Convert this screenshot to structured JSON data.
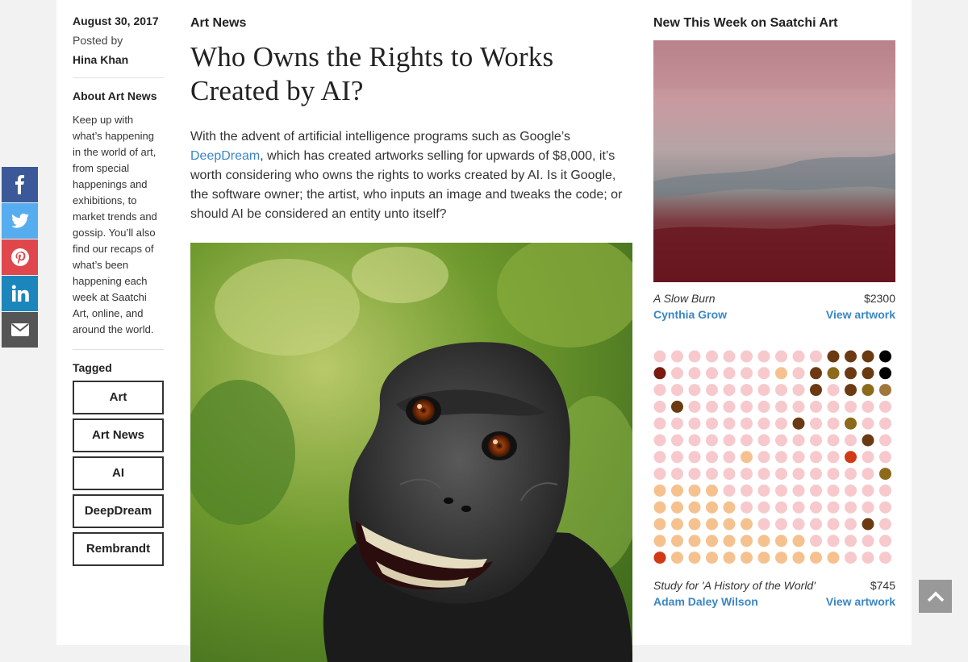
{
  "meta": {
    "date": "August 30, 2017",
    "posted_by": "Posted by",
    "author": "Hina Khan",
    "about_heading": "About Art News",
    "about_text": "Keep up with what’s happening in the world of art, from special happenings and exhibitions, to market trends and gossip. You’ll also find our recaps of what’s been happening each week at Saatchi Art, online, and around the world.",
    "tagged_heading": "Tagged",
    "tags": [
      "Art",
      "Art News",
      "AI",
      "DeepDream",
      "Rembrandt"
    ]
  },
  "article": {
    "category": "Art News",
    "title": "Who Owns the Rights to Works Created by AI?",
    "intro_before": "With the advent of artificial intelligence programs such as Google’s ",
    "intro_link": "DeepDream",
    "intro_after": ", which has created artworks selling for upwards of $8,000, it’s worth considering who owns the rights to works created by AI. Is it Google, the software owner; the artist, who inputs an image and tweaks the code; or should AI be considered an entity unto itself?"
  },
  "sidebar": {
    "heading": "New This Week on Saatchi Art",
    "artworks": [
      {
        "title": "A Slow Burn",
        "price": "$2300",
        "artist": "Cynthia Grow",
        "link": "View artwork"
      },
      {
        "title": "Study for 'A History of the World'",
        "price": "$745",
        "artist": "Adam Daley Wilson",
        "link": "View artwork"
      }
    ]
  },
  "share": {
    "icons": [
      "facebook-icon",
      "twitter-icon",
      "pinterest-icon",
      "linkedin-icon",
      "email-icon"
    ],
    "colors": [
      "#3b5998",
      "#55acee",
      "#e0474c",
      "#1b86bc",
      "#555555"
    ]
  },
  "colors": {
    "link": "#3a86c4",
    "dot_palette": [
      "#f7c9cc",
      "#f5c28f",
      "#6b3a12",
      "#8b6a1a",
      "#000000",
      "#7a1a10",
      "#d13a16",
      "#a0763a"
    ]
  }
}
